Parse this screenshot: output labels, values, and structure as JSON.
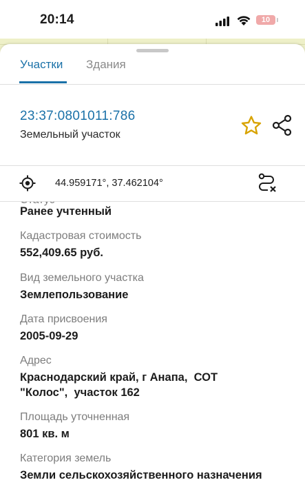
{
  "status_bar": {
    "time": "20:14",
    "battery": "10"
  },
  "tabs": [
    {
      "label": "Участки",
      "active": true
    },
    {
      "label": "Здания",
      "active": false
    }
  ],
  "parcel": {
    "cadastral_number": "23:37:0801011:786",
    "type": "Земельный участок",
    "coordinates": "44.959171°, 37.462104°"
  },
  "properties": {
    "status_value": "Ранее учтенный",
    "cost_label": "Кадастровая стоимость",
    "cost_value": "552,409.65 руб.",
    "use_label": "Вид земельного участка",
    "use_value": "Землепользование",
    "date_label": "Дата присвоения",
    "date_value": "2005-09-29",
    "address_label": "Адрес",
    "address_line1": "Краснодарский край, г Анапа,  СОТ",
    "address_line2": "\"Колос\",  участок 162",
    "area_label": "Площадь уточненная",
    "area_value": "801 кв. м",
    "category_label": "Категория земель",
    "category_value": "Земли сельскохозяйственного назначения"
  },
  "colors": {
    "accent": "#1a71a8",
    "star": "#d8a300",
    "battery_low": "#f0a9a9",
    "map_bg": "#eceecb"
  },
  "icons": {
    "favorite": "star-icon",
    "share": "share-icon",
    "locate": "crosshair-icon",
    "route": "route-clear-icon"
  }
}
